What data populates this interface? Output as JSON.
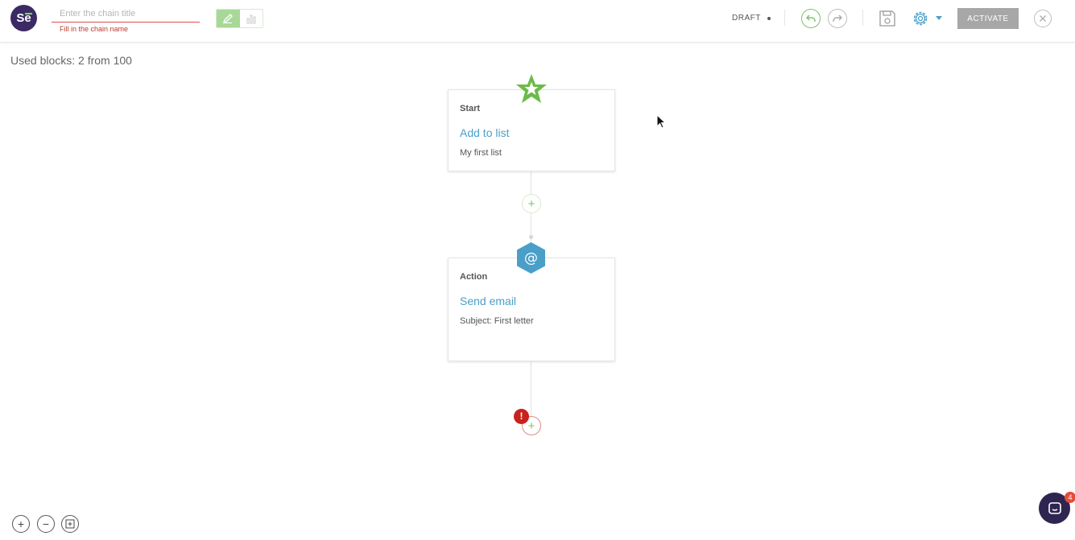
{
  "app": {
    "logo_text": "Se",
    "colors": {
      "brand": "#3b2a63",
      "accent_green": "#7cc26a",
      "link_blue": "#4a9fc8",
      "error_red": "#c9211e"
    }
  },
  "header": {
    "title_input": {
      "value": "",
      "placeholder": "Enter the chain title"
    },
    "title_error": "Fill in the chain name",
    "mode_icons": [
      "pencil-icon",
      "chart-icon"
    ],
    "status": "DRAFT",
    "undo_icon": "undo-icon",
    "redo_icon": "redo-icon",
    "save_icon": "save-icon",
    "settings_icon": "gear-icon",
    "activate_label": "ACTIVATE",
    "close_icon": "close-icon"
  },
  "canvas": {
    "used_blocks": "Used blocks: 2 from 100",
    "blocks": [
      {
        "icon": "star-icon",
        "type": "Start",
        "title": "Add to list",
        "subtitle": "My first list"
      },
      {
        "icon": "at-icon",
        "type": "Action",
        "title": "Send email",
        "subtitle": "Subject: First letter"
      }
    ],
    "add_symbol": "+",
    "error_symbol": "!"
  },
  "zoom_controls": {
    "zoom_in": "+",
    "zoom_out": "−"
  },
  "chat": {
    "count": "4"
  }
}
